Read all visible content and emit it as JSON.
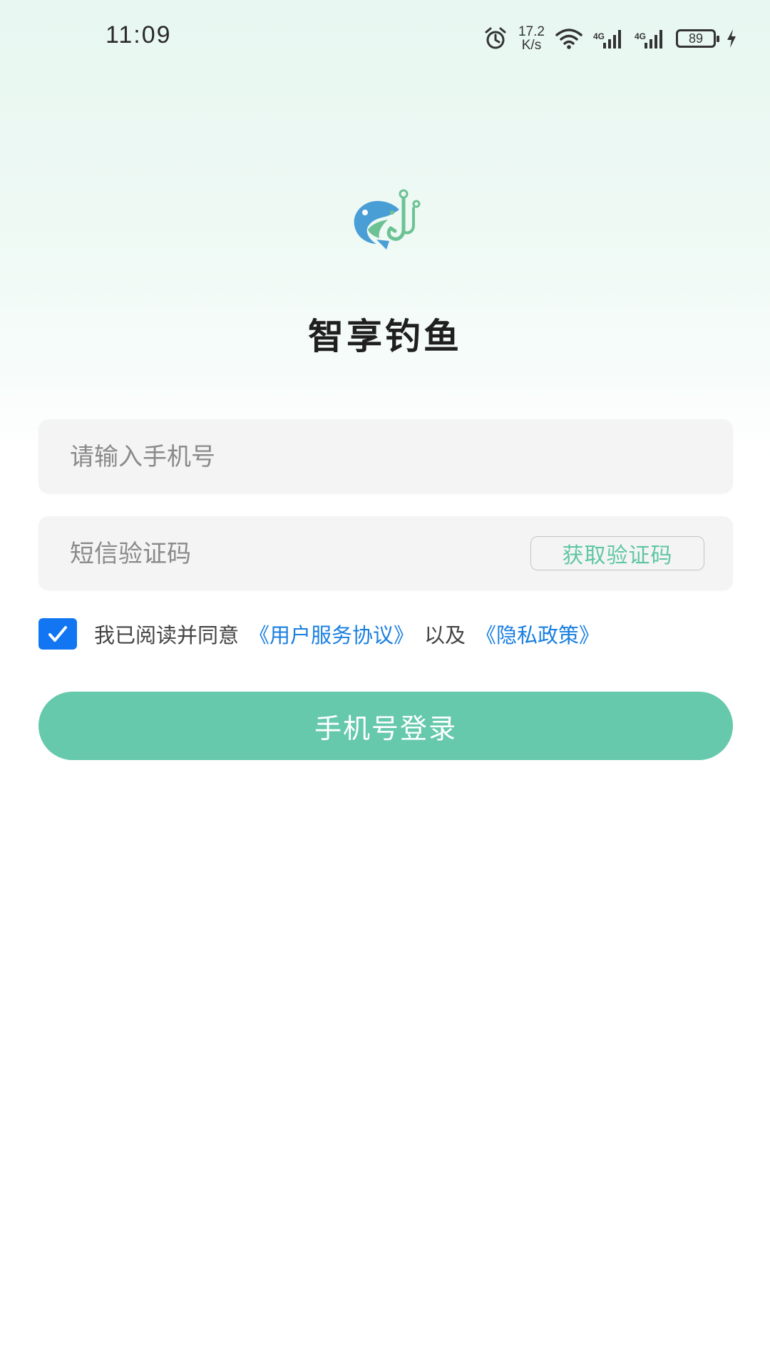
{
  "status_bar": {
    "time": "11:09",
    "net_speed_value": "17.2",
    "net_speed_unit": "K/s",
    "signal1_label": "4G",
    "signal2_label": "4G",
    "battery_level": "89"
  },
  "app": {
    "title": "智享钓鱼",
    "logo_icon": "fish-hook-logo-icon"
  },
  "login_form": {
    "phone_placeholder": "请输入手机号",
    "phone_value": "",
    "code_placeholder": "短信验证码",
    "code_value": "",
    "get_code_label": "获取验证码",
    "agree_checked": true,
    "agree_text": "我已阅读并同意",
    "user_agreement_link": "《用户服务协议》",
    "and_text": "以及",
    "privacy_link": "《隐私政策》",
    "login_label": "手机号登录"
  },
  "colors": {
    "accent_green": "#66c9ab",
    "link_blue": "#1a7fe0",
    "checkbox_blue": "#1276f2",
    "logo_blue": "#4a9ed6",
    "logo_green": "#6cc294"
  }
}
